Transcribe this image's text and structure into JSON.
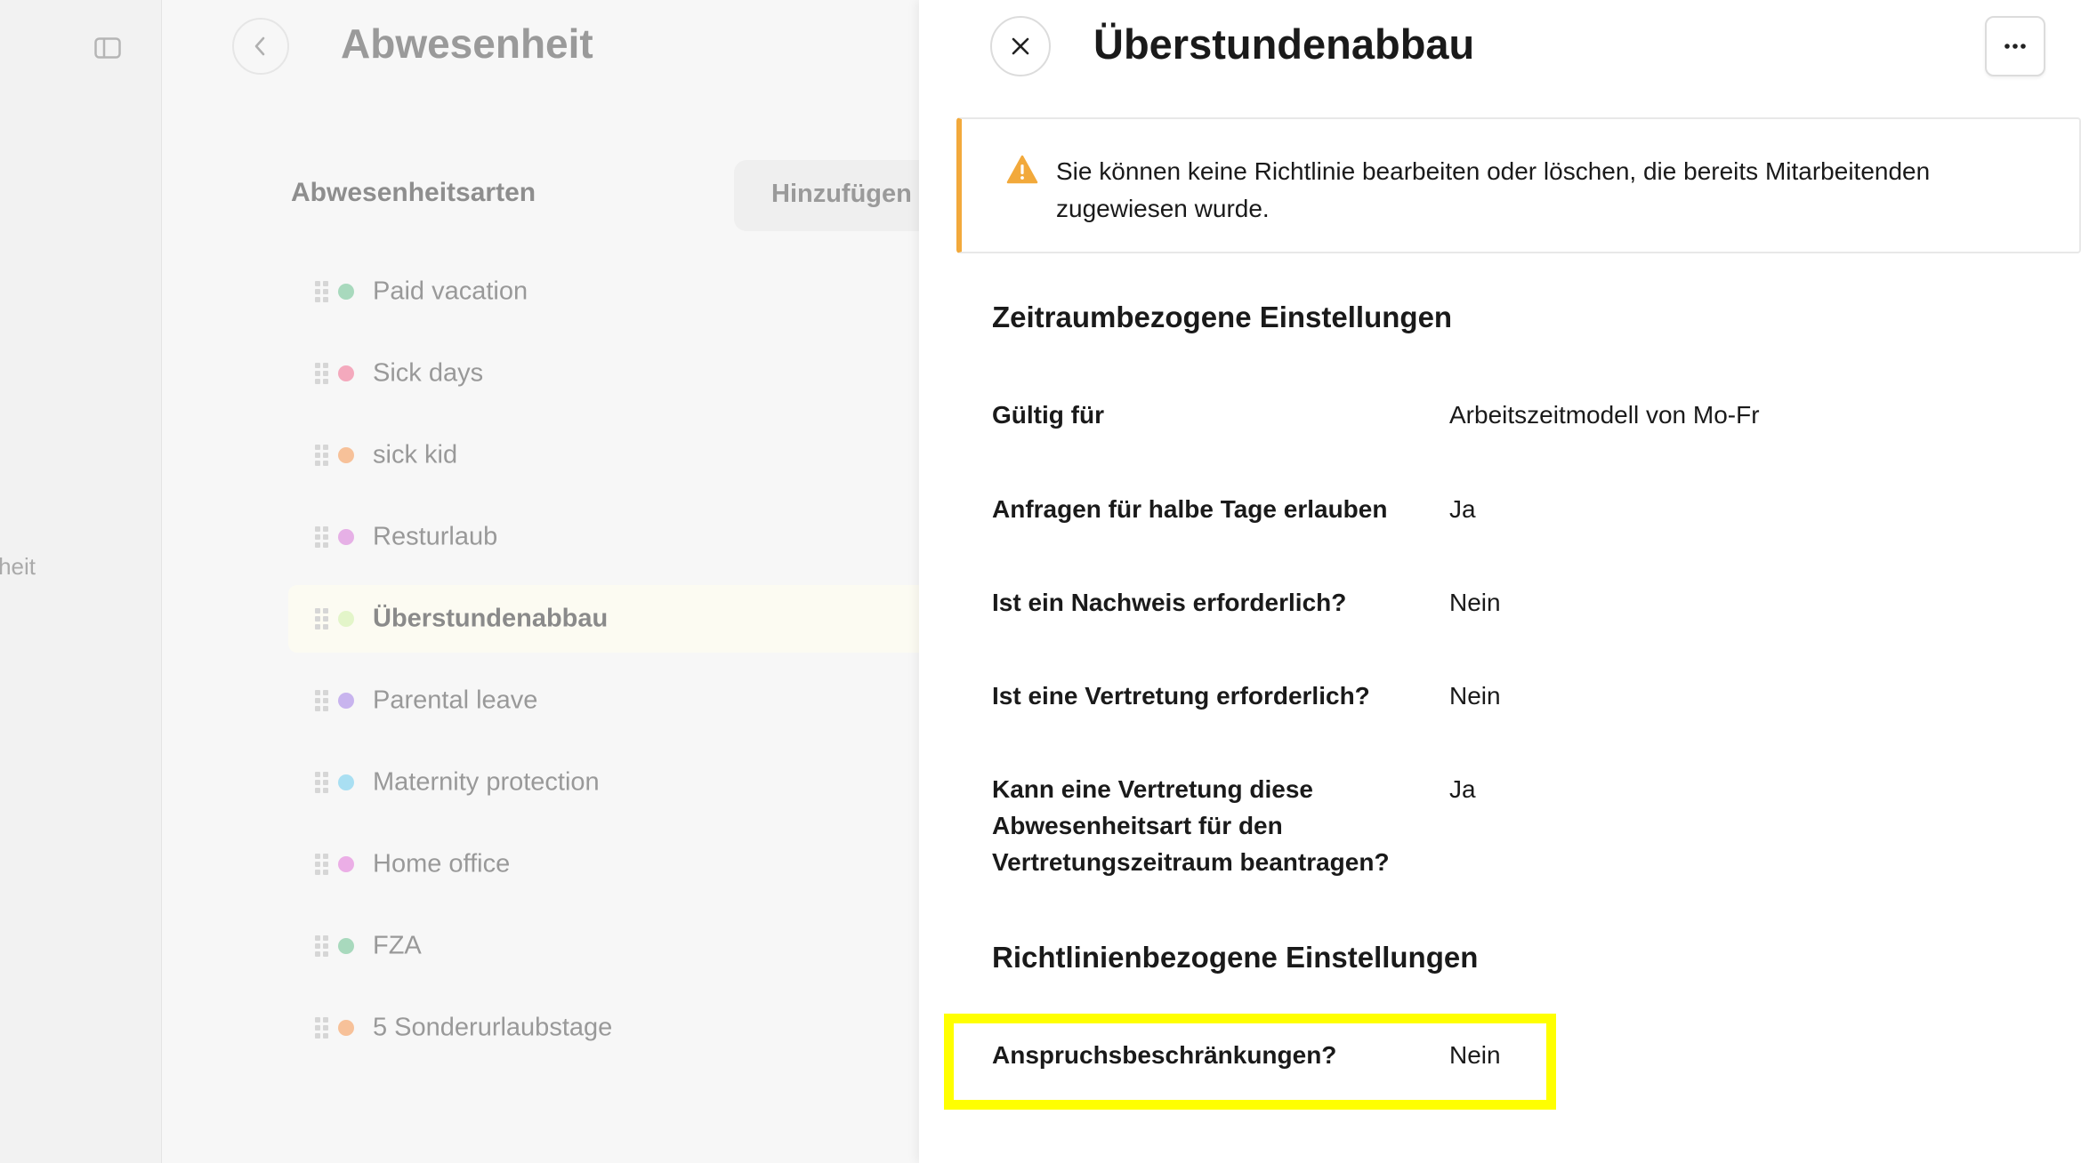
{
  "sidebar": {
    "toggle_icon": "sidebar-toggle-icon",
    "partial_label": "heit"
  },
  "header": {
    "back_icon": "chevron-left-icon",
    "title": "Abwesenheit"
  },
  "absence_types": {
    "section_title": "Abwesenheitsarten",
    "add_button": "Hinzufügen",
    "items": [
      {
        "label": "Paid vacation",
        "color": "#a8d9bd",
        "selected": false
      },
      {
        "label": "Sick days",
        "color": "#f4a9bd",
        "selected": false
      },
      {
        "label": "sick kid",
        "color": "#f7c199",
        "selected": false
      },
      {
        "label": "Resturlaub",
        "color": "#e6b0e6",
        "selected": false
      },
      {
        "label": "Überstundenabbau",
        "color": "#e3f5c9",
        "selected": true
      },
      {
        "label": "Parental leave",
        "color": "#c8b4ee",
        "selected": false
      },
      {
        "label": "Maternity protection",
        "color": "#a9dff2",
        "selected": false
      },
      {
        "label": "Home office",
        "color": "#ebaee6",
        "selected": false
      },
      {
        "label": "FZA",
        "color": "#a8d9bd",
        "selected": false
      },
      {
        "label": "5 Sonderurlaubstage",
        "color": "#f7c199",
        "selected": false
      }
    ]
  },
  "panel": {
    "close_icon": "close-icon",
    "title": "Überstundenabbau",
    "more_icon": "more-horizontal-icon",
    "alert": {
      "icon": "warning-icon",
      "color": "#f2a93b",
      "text": "Sie können keine Richtlinie bearbeiten oder löschen, die bereits Mitarbeitenden zugewiesen wurde."
    },
    "period_settings": {
      "heading": "Zeitraumbezogene Einstellungen",
      "rows": [
        {
          "label": "Gültig für",
          "value": "Arbeitszeitmodell von Mo-Fr"
        },
        {
          "label": "Anfragen für halbe Tage erlauben",
          "value": "Ja"
        },
        {
          "label": "Ist ein Nachweis erforderlich?",
          "value": "Nein"
        },
        {
          "label": "Ist eine Vertretung erforderlich?",
          "value": "Nein"
        },
        {
          "label": "Kann eine Vertretung diese Abwesenheitsart für den Vertretungszeitraum beantragen?",
          "value": "Ja"
        }
      ]
    },
    "policy_settings": {
      "heading": "Richtlinienbezogene Einstellungen",
      "rows": [
        {
          "label": "Anspruchsbeschränkungen?",
          "value": "Nein"
        }
      ]
    },
    "highlight_color": "#ffff00"
  }
}
